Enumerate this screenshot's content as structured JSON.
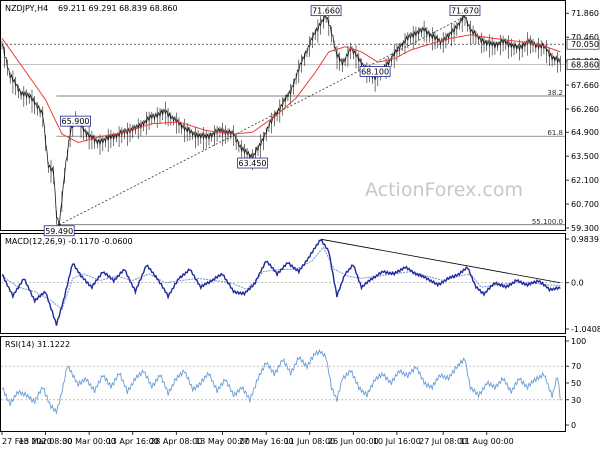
{
  "chart_data": [
    {
      "type": "candlestick",
      "panel": "price",
      "title": "NZDJPY,H4",
      "ohlc_header": "69.211 69.291 68.839 68.860",
      "ylim": [
        59.3,
        72.4
      ],
      "y_ticks": [
        "71.860",
        "70.460",
        "69.060",
        "67.660",
        "66.260",
        "64.900",
        "63.500",
        "62.100",
        "60.700",
        "59.300"
      ],
      "current_price": "68.860",
      "upper_marker": "70.050",
      "close_series": [
        [
          0,
          70.1
        ],
        [
          3,
          68.2
        ],
        [
          7,
          67.2
        ],
        [
          11,
          66.9
        ],
        [
          15,
          65.9
        ],
        [
          17,
          63.0
        ],
        [
          19,
          62.5
        ],
        [
          20,
          60.0
        ],
        [
          21,
          59.49
        ],
        [
          23,
          62.5
        ],
        [
          25,
          64.8
        ],
        [
          27,
          65.9
        ],
        [
          30,
          65.0
        ],
        [
          35,
          64.3
        ],
        [
          40,
          64.6
        ],
        [
          45,
          64.9
        ],
        [
          50,
          65.2
        ],
        [
          55,
          65.8
        ],
        [
          60,
          66.1
        ],
        [
          65,
          65.4
        ],
        [
          70,
          64.8
        ],
        [
          75,
          64.6
        ],
        [
          80,
          65.0
        ],
        [
          85,
          64.8
        ],
        [
          88,
          63.9
        ],
        [
          92,
          63.45
        ],
        [
          95,
          64.2
        ],
        [
          98,
          65.3
        ],
        [
          102,
          66.3
        ],
        [
          106,
          67.3
        ],
        [
          110,
          69.0
        ],
        [
          114,
          70.4
        ],
        [
          117,
          71.3
        ],
        [
          119,
          71.66
        ],
        [
          121,
          70.8
        ],
        [
          123,
          69.4
        ],
        [
          125,
          68.9
        ],
        [
          128,
          69.8
        ],
        [
          131,
          69.2
        ],
        [
          134,
          68.5
        ],
        [
          137,
          68.1
        ],
        [
          140,
          68.6
        ],
        [
          143,
          69.2
        ],
        [
          146,
          69.9
        ],
        [
          149,
          70.4
        ],
        [
          152,
          70.7
        ],
        [
          155,
          70.9
        ],
        [
          158,
          70.5
        ],
        [
          161,
          70.2
        ],
        [
          164,
          70.5
        ],
        [
          167,
          71.1
        ],
        [
          170,
          71.67
        ],
        [
          172,
          70.9
        ],
        [
          175,
          70.4
        ],
        [
          178,
          70.1
        ],
        [
          181,
          70.0
        ],
        [
          184,
          70.2
        ],
        [
          187,
          70.0
        ],
        [
          190,
          69.8
        ],
        [
          193,
          70.2
        ],
        [
          196,
          70.0
        ],
        [
          199,
          69.9
        ],
        [
          202,
          69.3
        ],
        [
          205,
          69.0
        ]
      ],
      "moving_average": [
        [
          0,
          70.4
        ],
        [
          8,
          68.6
        ],
        [
          16,
          66.8
        ],
        [
          22,
          64.8
        ],
        [
          28,
          64.3
        ],
        [
          35,
          64.6
        ],
        [
          45,
          64.9
        ],
        [
          55,
          65.4
        ],
        [
          65,
          65.5
        ],
        [
          75,
          65.0
        ],
        [
          85,
          64.8
        ],
        [
          92,
          64.9
        ],
        [
          100,
          65.8
        ],
        [
          108,
          66.9
        ],
        [
          115,
          68.4
        ],
        [
          120,
          69.6
        ],
        [
          126,
          69.9
        ],
        [
          132,
          69.6
        ],
        [
          138,
          69.0
        ],
        [
          144,
          69.2
        ],
        [
          150,
          69.7
        ],
        [
          158,
          70.1
        ],
        [
          165,
          70.4
        ],
        [
          172,
          70.6
        ],
        [
          180,
          70.4
        ],
        [
          190,
          70.2
        ],
        [
          198,
          70.0
        ],
        [
          205,
          69.6
        ]
      ],
      "annotations": [
        {
          "text": "71.660",
          "x": 119,
          "y": 71.66
        },
        {
          "text": "71.670",
          "x": 170,
          "y": 71.67
        },
        {
          "text": "68.100",
          "x": 137,
          "y": 68.1
        },
        {
          "text": "65.900",
          "x": 27,
          "y": 65.9
        },
        {
          "text": "63.450",
          "x": 92,
          "y": 63.45
        },
        {
          "text": "59.490",
          "x": 21,
          "y": 59.49
        }
      ],
      "trendline": [
        [
          21,
          59.49
        ],
        [
          170,
          71.67
        ]
      ],
      "fib_levels": [
        {
          "label": "38.2",
          "value": 67.02
        },
        {
          "label": "61.8",
          "value": 64.67
        },
        {
          "label": "55.100.0",
          "value": 59.49
        }
      ],
      "top_level": 70.05,
      "watermark": "ActionForex.com"
    },
    {
      "type": "line",
      "panel": "macd",
      "title": "MACD(12,26,9) -0.1170 -0.0600",
      "ylim": [
        -1.0408,
        0.9839
      ],
      "y_ticks": [
        "0.9839",
        "0.0",
        "-1.0408"
      ],
      "macd": [
        [
          0,
          0.2
        ],
        [
          4,
          -0.3
        ],
        [
          8,
          0.1
        ],
        [
          12,
          -0.4
        ],
        [
          16,
          -0.2
        ],
        [
          20,
          -0.95
        ],
        [
          23,
          -0.3
        ],
        [
          26,
          0.45
        ],
        [
          29,
          0.15
        ],
        [
          33,
          -0.1
        ],
        [
          37,
          0.25
        ],
        [
          41,
          0.05
        ],
        [
          45,
          0.3
        ],
        [
          49,
          -0.2
        ],
        [
          53,
          0.4
        ],
        [
          57,
          0.1
        ],
        [
          61,
          -0.3
        ],
        [
          65,
          0.1
        ],
        [
          69,
          0.3
        ],
        [
          73,
          -0.1
        ],
        [
          77,
          0.05
        ],
        [
          81,
          0.2
        ],
        [
          85,
          -0.2
        ],
        [
          89,
          -0.25
        ],
        [
          93,
          0.0
        ],
        [
          97,
          0.5
        ],
        [
          101,
          0.2
        ],
        [
          105,
          0.45
        ],
        [
          109,
          0.25
        ],
        [
          113,
          0.6
        ],
        [
          117,
          0.98
        ],
        [
          120,
          0.7
        ],
        [
          123,
          -0.3
        ],
        [
          126,
          0.2
        ],
        [
          129,
          0.4
        ],
        [
          132,
          -0.1
        ],
        [
          136,
          0.1
        ],
        [
          140,
          0.25
        ],
        [
          144,
          0.2
        ],
        [
          148,
          0.35
        ],
        [
          152,
          0.2
        ],
        [
          156,
          0.1
        ],
        [
          160,
          -0.05
        ],
        [
          164,
          0.1
        ],
        [
          168,
          0.2
        ],
        [
          171,
          0.35
        ],
        [
          174,
          -0.1
        ],
        [
          177,
          -0.25
        ],
        [
          181,
          0.0
        ],
        [
          185,
          -0.1
        ],
        [
          189,
          0.05
        ],
        [
          193,
          -0.05
        ],
        [
          197,
          0.05
        ],
        [
          201,
          -0.15
        ],
        [
          205,
          -0.117
        ]
      ],
      "signal": [
        [
          0,
          0.15
        ],
        [
          6,
          -0.1
        ],
        [
          12,
          -0.2
        ],
        [
          18,
          -0.4
        ],
        [
          22,
          -0.6
        ],
        [
          26,
          0.1
        ],
        [
          30,
          0.2
        ],
        [
          36,
          0.05
        ],
        [
          42,
          0.15
        ],
        [
          48,
          0.05
        ],
        [
          54,
          0.2
        ],
        [
          60,
          0.0
        ],
        [
          66,
          0.05
        ],
        [
          72,
          0.1
        ],
        [
          78,
          0.05
        ],
        [
          84,
          0.0
        ],
        [
          90,
          -0.15
        ],
        [
          96,
          0.25
        ],
        [
          102,
          0.3
        ],
        [
          108,
          0.3
        ],
        [
          114,
          0.5
        ],
        [
          118,
          0.8
        ],
        [
          122,
          0.3
        ],
        [
          127,
          0.15
        ],
        [
          132,
          0.1
        ],
        [
          138,
          0.15
        ],
        [
          144,
          0.2
        ],
        [
          150,
          0.25
        ],
        [
          156,
          0.15
        ],
        [
          162,
          0.05
        ],
        [
          168,
          0.15
        ],
        [
          172,
          0.2
        ],
        [
          176,
          -0.1
        ],
        [
          182,
          -0.05
        ],
        [
          188,
          0.0
        ],
        [
          194,
          0.0
        ],
        [
          200,
          -0.05
        ],
        [
          205,
          -0.06
        ]
      ],
      "trendline": [
        [
          117,
          0.98
        ],
        [
          205,
          0.0
        ]
      ]
    },
    {
      "type": "line",
      "panel": "rsi",
      "title": "RSI(14) 31.1222",
      "ylim": [
        0,
        100
      ],
      "y_ticks": [
        "100",
        "70",
        "50",
        "30",
        "0"
      ],
      "levels": [
        70,
        30
      ],
      "rsi": [
        [
          0,
          45
        ],
        [
          3,
          25
        ],
        [
          6,
          40
        ],
        [
          9,
          35
        ],
        [
          12,
          28
        ],
        [
          15,
          45
        ],
        [
          18,
          22
        ],
        [
          20,
          15
        ],
        [
          22,
          40
        ],
        [
          24,
          70
        ],
        [
          26,
          60
        ],
        [
          28,
          48
        ],
        [
          31,
          55
        ],
        [
          34,
          40
        ],
        [
          37,
          60
        ],
        [
          40,
          45
        ],
        [
          43,
          62
        ],
        [
          46,
          40
        ],
        [
          49,
          55
        ],
        [
          52,
          65
        ],
        [
          55,
          45
        ],
        [
          58,
          60
        ],
        [
          61,
          38
        ],
        [
          64,
          55
        ],
        [
          67,
          65
        ],
        [
          70,
          42
        ],
        [
          73,
          50
        ],
        [
          76,
          62
        ],
        [
          79,
          40
        ],
        [
          82,
          55
        ],
        [
          85,
          35
        ],
        [
          88,
          45
        ],
        [
          91,
          30
        ],
        [
          94,
          55
        ],
        [
          97,
          75
        ],
        [
          100,
          60
        ],
        [
          103,
          78
        ],
        [
          106,
          62
        ],
        [
          109,
          80
        ],
        [
          112,
          70
        ],
        [
          115,
          85
        ],
        [
          117,
          88
        ],
        [
          119,
          80
        ],
        [
          121,
          45
        ],
        [
          123,
          30
        ],
        [
          125,
          55
        ],
        [
          128,
          65
        ],
        [
          131,
          45
        ],
        [
          134,
          35
        ],
        [
          137,
          55
        ],
        [
          140,
          60
        ],
        [
          143,
          50
        ],
        [
          146,
          65
        ],
        [
          149,
          58
        ],
        [
          152,
          70
        ],
        [
          155,
          50
        ],
        [
          158,
          45
        ],
        [
          161,
          60
        ],
        [
          164,
          55
        ],
        [
          167,
          70
        ],
        [
          170,
          78
        ],
        [
          172,
          45
        ],
        [
          175,
          35
        ],
        [
          178,
          50
        ],
        [
          181,
          45
        ],
        [
          184,
          55
        ],
        [
          187,
          40
        ],
        [
          190,
          55
        ],
        [
          193,
          45
        ],
        [
          196,
          55
        ],
        [
          199,
          60
        ],
        [
          202,
          35
        ],
        [
          204,
          58
        ],
        [
          205,
          31
        ]
      ]
    }
  ],
  "x_axis": {
    "range": [
      0,
      206
    ],
    "ticks": [
      {
        "label": "27 Feb 2020",
        "x": 0
      },
      {
        "label": "13 Mar 08:00",
        "x": 16
      },
      {
        "label": "30 Mar 00:00",
        "x": 32
      },
      {
        "label": "13 Apr 16:00",
        "x": 48
      },
      {
        "label": "28 Apr 08:00",
        "x": 64
      },
      {
        "label": "13 May 00:00",
        "x": 81
      },
      {
        "label": "27 May 16:00",
        "x": 97
      },
      {
        "label": "11 Jun 08:00",
        "x": 113
      },
      {
        "label": "26 Jun 00:00",
        "x": 129
      },
      {
        "label": "10 Jul 16:00",
        "x": 145
      },
      {
        "label": "27 Jul 08:00",
        "x": 162
      },
      {
        "label": "11 Aug 00:00",
        "x": 178
      }
    ]
  },
  "colors": {
    "candles": "#1a1a1a",
    "moving_average": "#e8403c",
    "macd": "#1e2a9a",
    "signal": "#7a8fd0",
    "rsi": "#6a9bd8",
    "fib": "#555555",
    "trend": "#333333"
  }
}
